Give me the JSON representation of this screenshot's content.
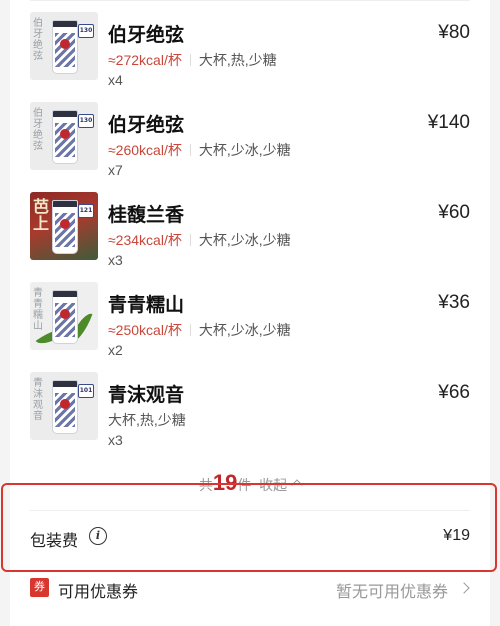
{
  "items": [
    {
      "name": "伯牙绝弦",
      "price": "¥80",
      "kcal": "≈272kcal/杯",
      "options": "大杯,热,少糖",
      "qty": "x4",
      "thumb_text": "伯牙绝弦",
      "tag": "130"
    },
    {
      "name": "伯牙绝弦",
      "price": "¥140",
      "kcal": "≈260kcal/杯",
      "options": "大杯,少冰,少糖",
      "qty": "x7",
      "thumb_text": "伯牙绝弦",
      "tag": "130"
    },
    {
      "name": "桂馥兰香",
      "price": "¥60",
      "kcal": "≈234kcal/杯",
      "options": "大杯,少冰,少糖",
      "qty": "x3",
      "thumb_text": "芭上",
      "tag": "121"
    },
    {
      "name": "青青糯山",
      "price": "¥36",
      "kcal": "≈250kcal/杯",
      "options": "大杯,少冰,少糖",
      "qty": "x2",
      "thumb_text": "青青糯山",
      "tag": ""
    },
    {
      "name": "青沫观音",
      "price": "¥66",
      "kcal": "",
      "options": "大杯,热,少糖",
      "qty": "x3",
      "thumb_text": "青沫观音",
      "tag": "101"
    }
  ],
  "summary": {
    "prefix": "共",
    "count": "19",
    "suffix": "件",
    "collapse": "收起"
  },
  "fee": {
    "label": "包装费",
    "value": "¥19",
    "info_glyph": "i"
  },
  "coupon": {
    "icon_text": "券",
    "label": "可用优惠券",
    "status": "暂无可用优惠券"
  },
  "colors": {
    "accent": "#d8372f",
    "kcal": "#c8463a"
  }
}
